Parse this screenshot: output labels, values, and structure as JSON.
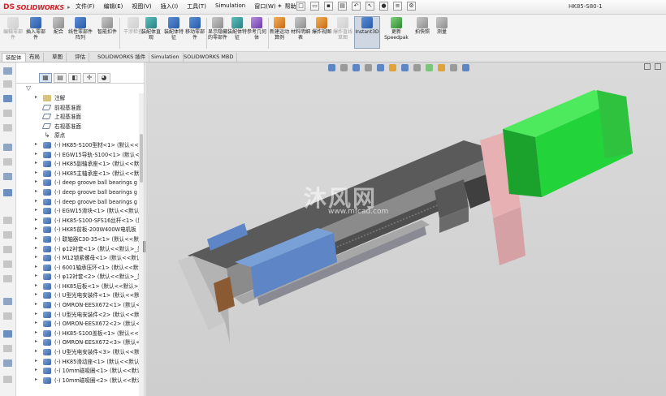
{
  "app": {
    "logo_text": "SOLIDWORKS",
    "logo_mark": "DS",
    "document_title": "HK85-S80-1"
  },
  "menu": [
    "文件(F)",
    "编辑(E)",
    "视图(V)",
    "插入(I)",
    "工具(T)",
    "Simulation",
    "窗口(W)",
    "帮助(H)"
  ],
  "ribbon": [
    {
      "label": "编辑零部件",
      "icon": "edit-component-icon",
      "disabled": true
    },
    {
      "label": "插入零部件",
      "icon": "insert-component-icon",
      "disabled": false
    },
    {
      "label": "配合",
      "icon": "mate-icon",
      "disabled": false
    },
    {
      "label": "线性零部件阵列",
      "icon": "linear-pattern-icon",
      "disabled": false
    },
    {
      "label": "智能扣件",
      "icon": "smart-fastener-icon",
      "disabled": false
    },
    {
      "label": "移动零部件",
      "icon": "move-component-icon",
      "disabled": false
    },
    {
      "label": "显示隐藏的零部件",
      "icon": "show-hidden-icon",
      "disabled": false
    },
    {
      "label": "装配体特征",
      "icon": "assembly-feature-icon",
      "disabled": false
    },
    {
      "label": "参考几何体",
      "icon": "reference-geometry-icon",
      "disabled": false
    },
    {
      "label": "新建运动算例",
      "icon": "new-motion-study-icon",
      "disabled": false
    },
    {
      "label": "材料明细表",
      "icon": "bom-icon",
      "disabled": false
    },
    {
      "label": "爆炸视图",
      "icon": "exploded-view-icon",
      "disabled": false
    },
    {
      "label": "爆炸直线草图",
      "icon": "explode-line-sketch-icon",
      "disabled": true
    },
    {
      "label": "Instant3D",
      "icon": "instant3d-icon",
      "disabled": false,
      "active": true
    },
    {
      "label": "更新 Speedpak",
      "icon": "speedpak-icon",
      "disabled": false
    },
    {
      "label": "拍快照",
      "icon": "snapshot-icon",
      "disabled": false
    },
    {
      "label": "测量",
      "icon": "measure-icon",
      "disabled": false
    }
  ],
  "ribbon_extra": [
    "干涉检查",
    "装配体直观",
    "装配体特征",
    "新建运动算例"
  ],
  "command_tabs": [
    "装配体",
    "布局",
    "草图",
    "评估",
    "SOLIDWORKS 插件",
    "Simulation",
    "SOLIDWORKS MBD"
  ],
  "fm_tab_icons": [
    "feature-manager-icon",
    "property-manager-icon",
    "configuration-manager-icon",
    "dimxpert-icon",
    "display-manager-icon"
  ],
  "tree": [
    {
      "label": "注解",
      "icon": "annotations-icon",
      "kind": "note"
    },
    {
      "label": "前视基准面",
      "icon": "plane-icon",
      "kind": "plane"
    },
    {
      "label": "上视基准面",
      "icon": "plane-icon",
      "kind": "plane"
    },
    {
      "label": "右视基准面",
      "icon": "plane-icon",
      "kind": "plane"
    },
    {
      "label": "原点",
      "icon": "origin-icon",
      "kind": "origin"
    },
    {
      "label": "(-) HK85-S100型材<1> (默认<<默认",
      "icon": "component-icon",
      "kind": "comp"
    },
    {
      "label": "(-) EGW15导轨-S100<1> (默认<<默",
      "icon": "component-icon",
      "kind": "comp"
    },
    {
      "label": "(-) HK85副轴承座<1> (默认<<默认",
      "icon": "component-icon",
      "kind": "comp"
    },
    {
      "label": "(-) HK85主轴承座<1> (默认<<默认",
      "icon": "component-icon",
      "kind": "comp"
    },
    {
      "label": "(-) deep groove ball bearings g",
      "icon": "component-icon",
      "kind": "comp"
    },
    {
      "label": "(-) deep groove ball bearings g",
      "icon": "component-icon",
      "kind": "comp"
    },
    {
      "label": "(-) deep groove ball bearings g",
      "icon": "component-icon",
      "kind": "comp"
    },
    {
      "label": "(-) EGW15滑块<1> (默认<<默认>",
      "icon": "component-icon",
      "kind": "comp"
    },
    {
      "label": "(-) HK85-S100-SFS16丝杆<1> (默认",
      "icon": "component-icon",
      "kind": "comp"
    },
    {
      "label": "(-) HK85前板-200W400W电机板",
      "icon": "component-icon",
      "kind": "comp"
    },
    {
      "label": "(-) 联轴器C30-35<1> (默认<<默认",
      "icon": "component-icon",
      "kind": "comp"
    },
    {
      "label": "(-) φ12衬套<1> (默认<<默认>_显",
      "icon": "component-icon",
      "kind": "comp"
    },
    {
      "label": "(-) M12锁紧螺母<1> (默认<<默认",
      "icon": "component-icon",
      "kind": "comp"
    },
    {
      "label": "(-) 6001轴承压环<1> (默认<<默认",
      "icon": "component-icon",
      "kind": "comp"
    },
    {
      "label": "(-) φ12衬套<2> (默认<<默认>_显",
      "icon": "component-icon",
      "kind": "comp"
    },
    {
      "label": "(-) HK85后板<1> (默认<<默认>_显",
      "icon": "component-icon",
      "kind": "comp"
    },
    {
      "label": "(-) U型光电安装件<1> (默认<<默认",
      "icon": "component-icon",
      "kind": "comp"
    },
    {
      "label": "(-) OMRON-EESX672<1> (默认<<默",
      "icon": "component-icon",
      "kind": "comp"
    },
    {
      "label": "(-) U型光电安装件<2> (默认<<默认",
      "icon": "component-icon",
      "kind": "comp"
    },
    {
      "label": "(-) OMRON-EESX672<2> (默认<<默",
      "icon": "component-icon",
      "kind": "comp"
    },
    {
      "label": "(-) HK85-S100盖板<1> (默认<<默",
      "icon": "component-icon",
      "kind": "comp"
    },
    {
      "label": "(-) OMRON-EESX672<3> (默认<<默",
      "icon": "component-icon",
      "kind": "comp"
    },
    {
      "label": "(-) U型光电安装件<3> (默认<<默认",
      "icon": "component-icon",
      "kind": "comp"
    },
    {
      "label": "(-) HK85滑动座<1> (默认<<默认",
      "icon": "component-icon",
      "kind": "comp"
    },
    {
      "label": "(-) 10mm磁吸圈<1> (默认<<默认",
      "icon": "component-icon",
      "kind": "comp"
    },
    {
      "label": "(-) 10mm磁吸圈<2> (默认<<默认",
      "icon": "component-icon",
      "kind": "comp"
    }
  ],
  "watermark": {
    "cn": "沐风网",
    "url": "www.mfcad.com"
  },
  "colors": {
    "motor": "#22d43a",
    "motor_flange": "#e7b1b4",
    "slider": "#5e86c6",
    "rail_profile": "#3a3a3a",
    "end_plate": "#c8c8c8",
    "viewport_bg": "#d4d4d4",
    "brand": "#d2232a"
  }
}
